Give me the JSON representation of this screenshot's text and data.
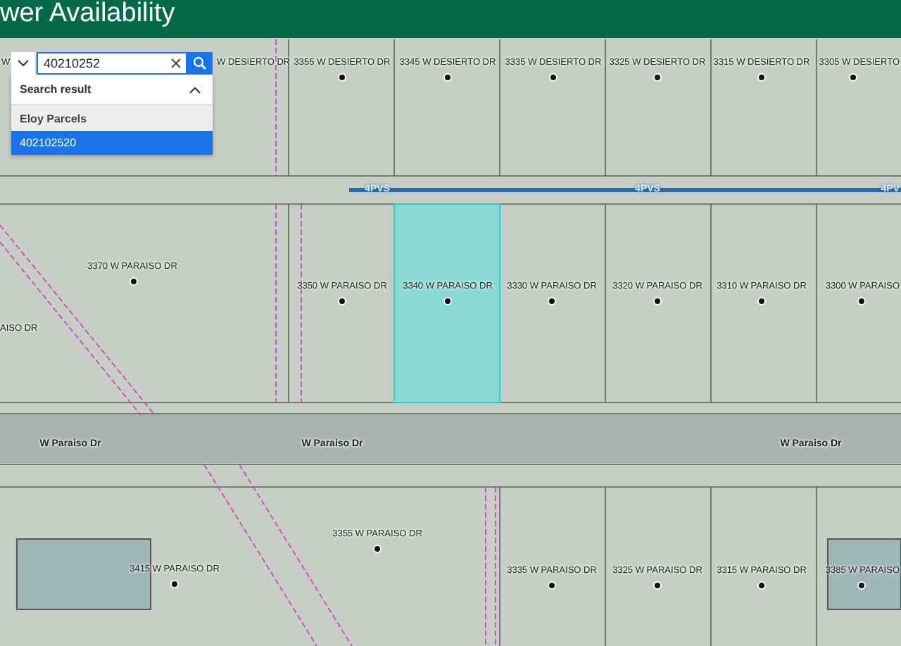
{
  "header": {
    "title": "wer Availability"
  },
  "search": {
    "value": "40210252",
    "expanded": true,
    "results_title": "Search result",
    "groups": [
      {
        "name": "Eloy Parcels",
        "results": [
          {
            "label": "402102520",
            "selected": true
          }
        ]
      }
    ]
  },
  "map": {
    "parcels": [
      {
        "label": "W",
        "selected": false
      },
      {
        "label": "W DESIERTO DR",
        "selected": false
      },
      {
        "label": "3355 W DESIERTO DR",
        "selected": false
      },
      {
        "label": "3345 W DESIERTO DR",
        "selected": false
      },
      {
        "label": "3335 W DESIERTO DR",
        "selected": false
      },
      {
        "label": "3325 W DESIERTO DR",
        "selected": false
      },
      {
        "label": "3315 W DESIERTO DR",
        "selected": false
      },
      {
        "label": "3305 W DESIERTO",
        "selected": false
      },
      {
        "label": "3370 W PARAISO DR",
        "selected": false
      },
      {
        "label": "3350 W PARAISO DR",
        "selected": false
      },
      {
        "label": "3340 W PARAISO DR",
        "selected": true
      },
      {
        "label": "3330 W PARAISO DR",
        "selected": false
      },
      {
        "label": "3320 W PARAISO DR",
        "selected": false
      },
      {
        "label": "3310 W PARAISO DR",
        "selected": false
      },
      {
        "label": "3300 W PARAISO",
        "selected": false
      },
      {
        "label": "AISO DR",
        "selected": false
      },
      {
        "label": "3355 W PARAISO DR",
        "selected": false
      },
      {
        "label": "3415 W PARAISO DR",
        "selected": false
      },
      {
        "label": "3335 W PARAISO DR",
        "selected": false
      },
      {
        "label": "3325 W PARAISO DR",
        "selected": false
      },
      {
        "label": "3315 W PARAISO DR",
        "selected": false
      },
      {
        "label": "3385 W PARAISO",
        "selected": false
      }
    ],
    "roads": [
      {
        "label": "4PVS",
        "kind": "line"
      },
      {
        "label": "4PVS",
        "kind": "line"
      },
      {
        "label": "4PV",
        "kind": "line"
      },
      {
        "label": "W Paraiso Dr",
        "kind": "street"
      },
      {
        "label": "W Paraiso Dr",
        "kind": "street"
      },
      {
        "label": "W Paraiso Dr",
        "kind": "street"
      }
    ]
  }
}
